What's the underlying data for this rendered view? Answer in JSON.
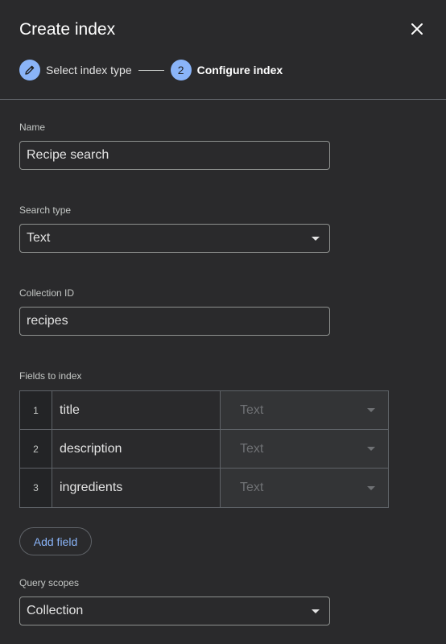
{
  "dialog": {
    "title": "Create index",
    "close_icon": "close-icon"
  },
  "stepper": {
    "steps": [
      {
        "icon": "pencil-icon",
        "label": "Select index type",
        "state": "completed"
      },
      {
        "number": "2",
        "label": "Configure index",
        "state": "active"
      }
    ]
  },
  "form": {
    "name": {
      "label": "Name",
      "value": "Recipe search"
    },
    "search_type": {
      "label": "Search type",
      "value": "Text"
    },
    "collection_id": {
      "label": "Collection ID",
      "value": "recipes"
    },
    "fields_to_index": {
      "label": "Fields to index",
      "rows": [
        {
          "number": "1",
          "name": "title",
          "type": "Text"
        },
        {
          "number": "2",
          "name": "description",
          "type": "Text"
        },
        {
          "number": "3",
          "name": "ingredients",
          "type": "Text"
        }
      ],
      "add_label": "Add field"
    },
    "query_scopes": {
      "label": "Query scopes",
      "value": "Collection"
    }
  },
  "colors": {
    "background": "#2a2a2c",
    "accent": "#8ab4f8",
    "border": "#8e918f",
    "muted_text": "#6f7174"
  }
}
